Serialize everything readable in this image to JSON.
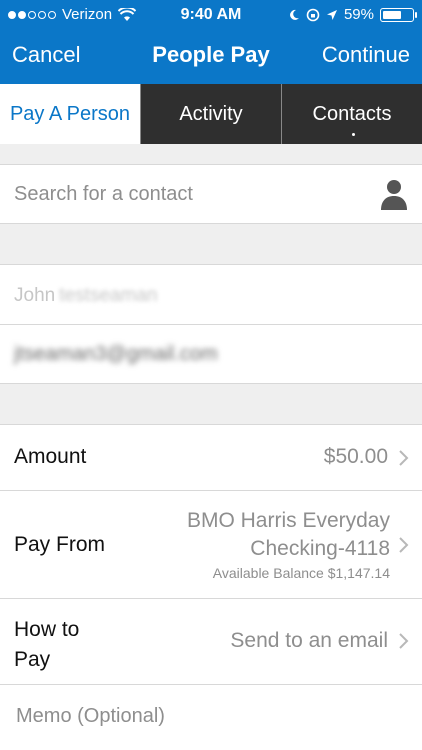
{
  "status_bar": {
    "carrier": "Verizon",
    "time": "9:40 AM",
    "battery": "59%",
    "battery_level": 0.59
  },
  "nav": {
    "cancel_label": "Cancel",
    "title": "People Pay",
    "continue_label": "Continue"
  },
  "tabs": [
    {
      "label": "Pay A Person",
      "active": true
    },
    {
      "label": "Activity",
      "active": false
    },
    {
      "label": "Contacts",
      "active": false
    }
  ],
  "search": {
    "placeholder": "Search for a contact"
  },
  "recipient": {
    "first_name": "John",
    "last_name": "testseaman",
    "email": "jtseaman3@gmail.com"
  },
  "payment": {
    "amount_label": "Amount",
    "amount_value": "$50.00",
    "pay_from_label": "Pay From",
    "pay_from_account_line1": "BMO Harris Everyday",
    "pay_from_account_line2": "Checking-4118",
    "available_balance": "Available Balance $1,147.14",
    "how_to_pay_label": "How to Pay",
    "how_to_pay_value": "Send to an email",
    "memo_placeholder": "Memo (Optional)"
  },
  "colors": {
    "accent": "#0b77c8",
    "tab_dark": "#2f2f2f"
  }
}
